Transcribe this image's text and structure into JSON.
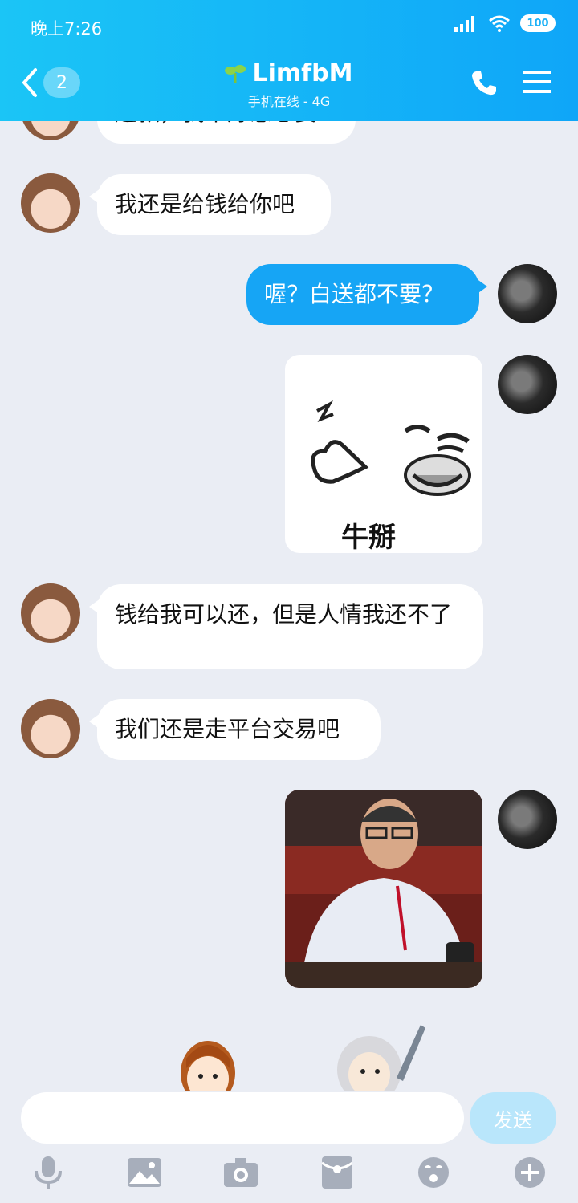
{
  "status": {
    "time": "晚上7:26",
    "battery": "100"
  },
  "header": {
    "back_count": "2",
    "title": "LimfbM",
    "subtitle": "手机在线 - 4G"
  },
  "messages": [
    {
      "text": "还款，我不好意思要"
    },
    {
      "text": "我还是给钱给你吧"
    },
    {
      "text": "喔？白送都不要？"
    },
    {
      "sticker_text": "牛掰"
    },
    {
      "text": "钱给我可以还，但是人情我还不了"
    },
    {
      "text": "我们还是走平台交易吧"
    }
  ],
  "composer": {
    "send_label": "发送",
    "input_value": ""
  },
  "colors": {
    "header_start": "#1bc5f6",
    "header_end": "#0fa6f8",
    "bubble_self": "#16a5f5",
    "chat_bg": "#eaedf4"
  }
}
